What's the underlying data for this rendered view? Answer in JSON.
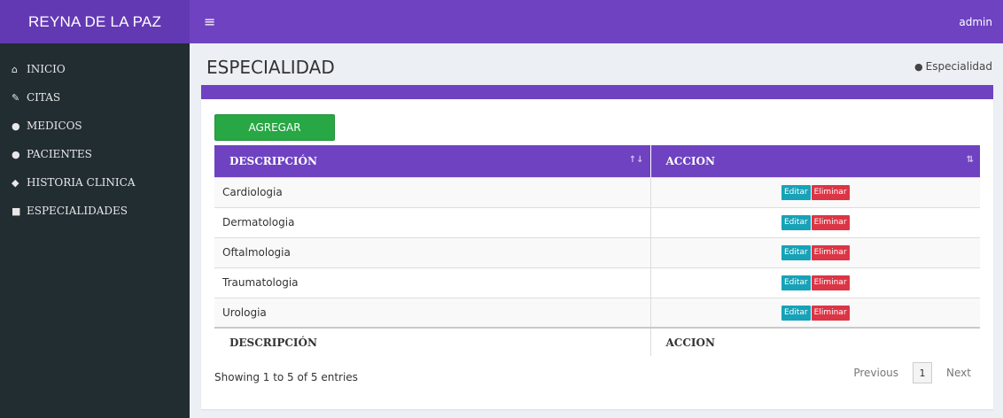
{
  "header": {
    "brand": "REYNA DE LA PAZ",
    "menu_icon": "hamburger-icon",
    "user": "admin"
  },
  "sidebar": {
    "items": [
      {
        "label": "INICIO",
        "icon": "home-icon"
      },
      {
        "label": "CITAS",
        "icon": "edit-icon"
      },
      {
        "label": "MEDICOS",
        "icon": "user-md-icon"
      },
      {
        "label": "PACIENTES",
        "icon": "user-icon"
      },
      {
        "label": "HISTORIA CLINICA",
        "icon": "users-icon"
      },
      {
        "label": "ESPECIALIDADES",
        "icon": "id-card-icon"
      }
    ]
  },
  "page": {
    "title": "ESPECIALIDAD",
    "breadcrumb": "Especialidad",
    "breadcrumb_icon": "user-icon"
  },
  "toolbar": {
    "add_label": "AGREGAR"
  },
  "table": {
    "columns": [
      "DESCRIPCIÓN",
      "ACCION"
    ],
    "rows": [
      {
        "descripcion": "Cardiologia"
      },
      {
        "descripcion": "Dermatologia"
      },
      {
        "descripcion": "Oftalmologia"
      },
      {
        "descripcion": "Traumatologia"
      },
      {
        "descripcion": "Urologia"
      }
    ],
    "edit_label": "Editar",
    "delete_label": "Eliminar"
  },
  "footer": {
    "info": "Showing 1 to 5 of 5 entries",
    "previous": "Previous",
    "page": "1",
    "next": "Next"
  },
  "colors": {
    "primary": "#6f42c1",
    "sidebar": "#222d32",
    "add": "#28a745",
    "edit": "#17a2b8",
    "delete": "#dc3545"
  }
}
